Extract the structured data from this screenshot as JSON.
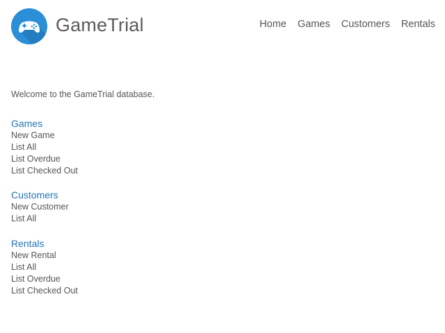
{
  "brand": {
    "name": "GameTrial",
    "logo_icon": "gamepad-icon",
    "accent": "#2a8fd6"
  },
  "nav": [
    {
      "label": "Home"
    },
    {
      "label": "Games"
    },
    {
      "label": "Customers"
    },
    {
      "label": "Rentals"
    }
  ],
  "welcome": "Welcome to the GameTrial database.",
  "sections": {
    "games": {
      "title": "Games",
      "links": [
        "New Game",
        "List All",
        "List Overdue",
        "List Checked Out"
      ]
    },
    "customers": {
      "title": "Customers",
      "links": [
        "New Customer",
        "List All"
      ]
    },
    "rentals": {
      "title": "Rentals",
      "links": [
        "New Rental",
        "List All",
        "List Overdue",
        "List Checked Out"
      ]
    }
  },
  "colors": {
    "section_heading": "#2374b8",
    "text": "#555555"
  }
}
